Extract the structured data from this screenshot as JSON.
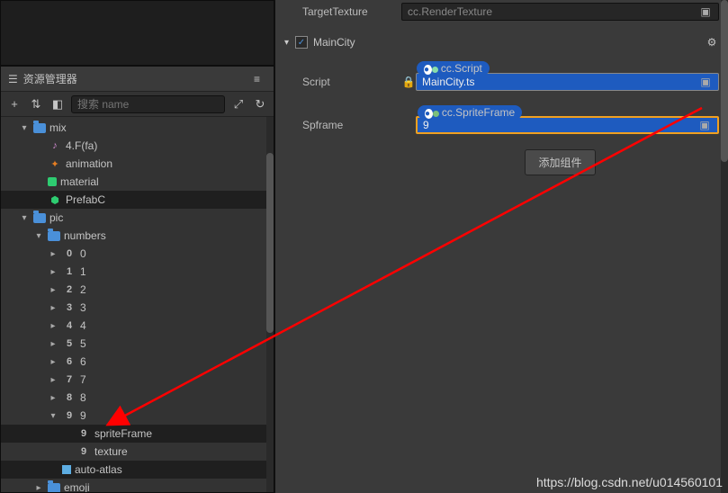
{
  "assets": {
    "title": "资源管理器",
    "search_placeholder": "搜索 name",
    "tree": [
      {
        "indent": 0,
        "arrow": "down",
        "iconType": "folder",
        "label": "mix",
        "selected": false
      },
      {
        "indent": 1,
        "arrow": "none",
        "iconType": "audio",
        "iconText": "♪",
        "label": "4.F(fa)",
        "selected": false
      },
      {
        "indent": 1,
        "arrow": "none",
        "iconType": "anim",
        "iconText": "✦",
        "label": "animation",
        "selected": false
      },
      {
        "indent": 1,
        "arrow": "none",
        "iconType": "material",
        "label": "material",
        "selected": false
      },
      {
        "indent": 1,
        "arrow": "none",
        "iconType": "prefab",
        "iconText": "⬢",
        "label": "PrefabC",
        "selected": true
      },
      {
        "indent": 0,
        "arrow": "down",
        "iconType": "folder",
        "label": "pic",
        "selected": false
      },
      {
        "indent": 1,
        "arrow": "down",
        "iconType": "folder",
        "label": "numbers",
        "selected": false
      },
      {
        "indent": 2,
        "arrow": "right",
        "iconType": "num",
        "iconText": "0",
        "label": "0",
        "selected": false
      },
      {
        "indent": 2,
        "arrow": "right",
        "iconType": "num",
        "iconText": "1",
        "label": "1",
        "selected": false
      },
      {
        "indent": 2,
        "arrow": "right",
        "iconType": "num",
        "iconText": "2",
        "label": "2",
        "selected": false
      },
      {
        "indent": 2,
        "arrow": "right",
        "iconType": "num",
        "iconText": "3",
        "label": "3",
        "selected": false
      },
      {
        "indent": 2,
        "arrow": "right",
        "iconType": "num",
        "iconText": "4",
        "label": "4",
        "selected": false
      },
      {
        "indent": 2,
        "arrow": "right",
        "iconType": "num",
        "iconText": "5",
        "label": "5",
        "selected": false
      },
      {
        "indent": 2,
        "arrow": "right",
        "iconType": "num",
        "iconText": "6",
        "label": "6",
        "selected": false
      },
      {
        "indent": 2,
        "arrow": "right",
        "iconType": "num",
        "iconText": "7",
        "label": "7",
        "selected": false
      },
      {
        "indent": 2,
        "arrow": "right",
        "iconType": "num",
        "iconText": "8",
        "label": "8",
        "selected": false
      },
      {
        "indent": 2,
        "arrow": "down",
        "iconType": "num",
        "iconText": "9",
        "label": "9",
        "selected": false
      },
      {
        "indent": 3,
        "arrow": "none",
        "iconType": "num",
        "iconText": "9",
        "label": "spriteFrame",
        "selected": true
      },
      {
        "indent": 3,
        "arrow": "none",
        "iconType": "num",
        "iconText": "9",
        "label": "texture",
        "selected": false
      },
      {
        "indent": 2,
        "arrow": "none",
        "iconType": "atlas",
        "label": "auto-atlas",
        "selected": true
      },
      {
        "indent": 1,
        "arrow": "right",
        "iconType": "folder",
        "label": "emoji",
        "selected": false
      }
    ]
  },
  "inspector": {
    "targetTexture_label": "TargetTexture",
    "targetTexture_value": "cc.RenderTexture",
    "component_name": "MainCity",
    "script_label": "Script",
    "script_tag": "cc.Script",
    "script_value": "MainCity.ts",
    "spframe_label": "Spframe",
    "spframe_tag": "cc.SpriteFrame",
    "spframe_value": "9",
    "add_component": "添加组件"
  },
  "watermark": "https://blog.csdn.net/u014560101"
}
